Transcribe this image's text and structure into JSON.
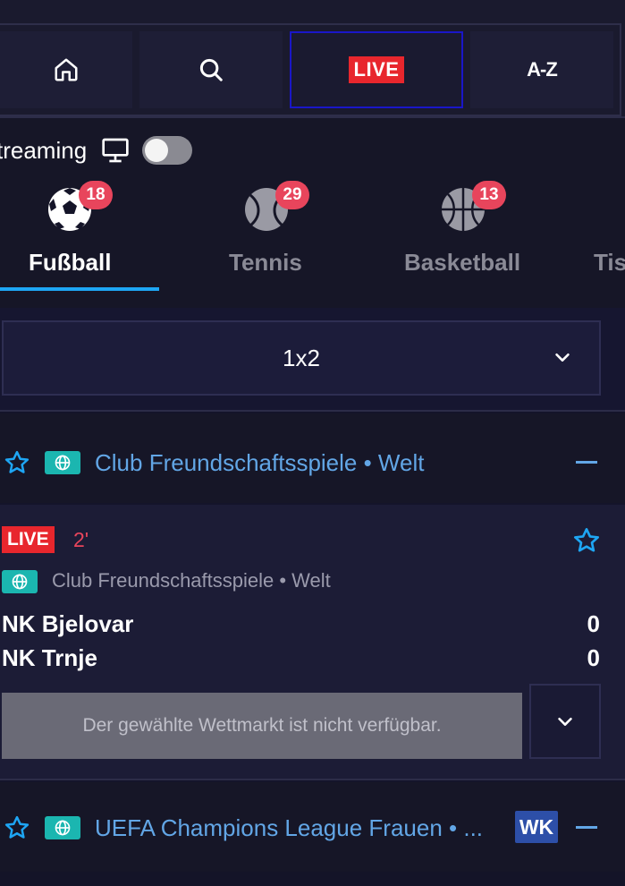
{
  "topnav": {
    "home_icon": "home-icon",
    "search_icon": "search-icon",
    "live_label": "LIVE",
    "az_label": "A-Z",
    "colors": {
      "live": "#e8262d",
      "active_border": "#1a16c8"
    }
  },
  "streaming": {
    "label": "treaming",
    "icon": "monitor-icon",
    "toggle_on": false
  },
  "sports": [
    {
      "label": "Fußball",
      "count": "18",
      "icon": "soccer-ball-icon",
      "active": true
    },
    {
      "label": "Tennis",
      "count": "29",
      "icon": "tennis-ball-icon",
      "active": false
    },
    {
      "label": "Basketball",
      "count": "13",
      "icon": "basketball-icon",
      "active": false
    },
    {
      "label": "Tis",
      "icon": "sport-icon",
      "active": false
    }
  ],
  "market": {
    "selected": "1x2",
    "chevron_icon": "chevron-down-icon"
  },
  "leagues": [
    {
      "name": "Club Freundschaftsspiele • Welt",
      "star_icon": "star-icon",
      "globe_icon": "globe-icon"
    },
    {
      "name": "UEFA Champions League Frauen • ...",
      "badge": "WK",
      "star_icon": "star-icon",
      "globe_icon": "globe-icon"
    }
  ],
  "event": {
    "live_label": "LIVE",
    "minute": "2'",
    "league": "Club Freundschaftsspiele • Welt",
    "home_team": "NK Bjelovar",
    "away_team": "NK Trnje",
    "home_score": "0",
    "away_score": "0",
    "unavailable_text": "Der gewählte Wettmarkt ist nicht verfügbar."
  }
}
